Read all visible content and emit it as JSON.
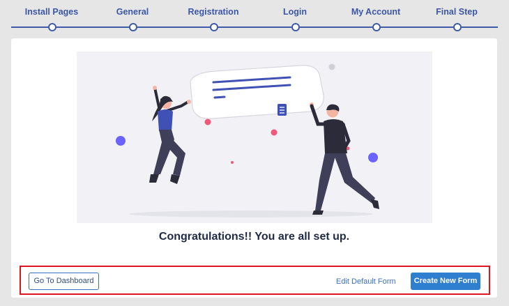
{
  "stepper": {
    "steps": [
      {
        "label": "Install Pages"
      },
      {
        "label": "General"
      },
      {
        "label": "Registration"
      },
      {
        "label": "Login"
      },
      {
        "label": "My Account"
      },
      {
        "label": "Final Step"
      }
    ]
  },
  "main": {
    "illustration_icon": "people-celebrating-illustration",
    "headline": "Congratulations!! You are all set up."
  },
  "actions": {
    "go_to_dashboard": "Go To Dashboard",
    "edit_default_form": "Edit Default Form",
    "create_new_form": "Create New Form"
  },
  "colors": {
    "accent": "#3f5aa8",
    "primary_button": "#2f7fd1",
    "highlight_border": "#e0141e"
  }
}
